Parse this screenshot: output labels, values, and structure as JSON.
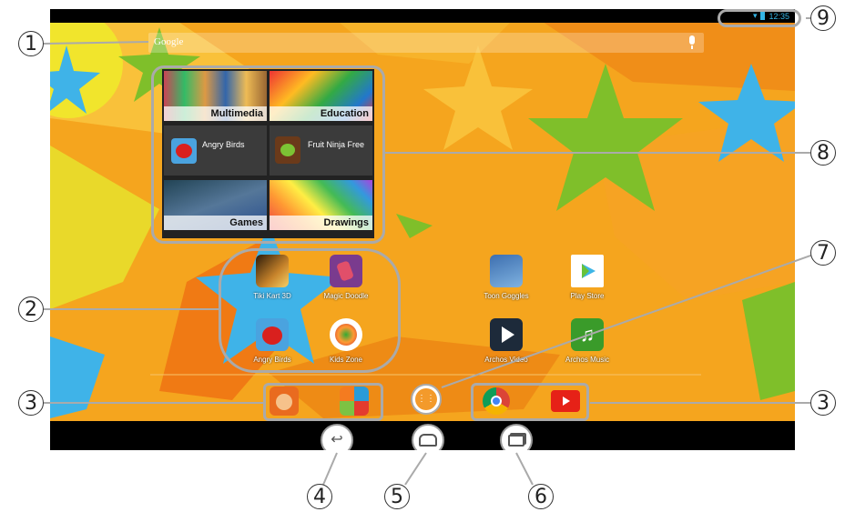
{
  "status": {
    "time": "12:35"
  },
  "search": {
    "placeholder": "Google"
  },
  "widgets": {
    "multimedia": "Multimedia",
    "education": "Education",
    "angry_birds": "Angry Birds",
    "fruit_ninja": "Fruit Ninja Free",
    "games": "Games",
    "drawings": "Drawings"
  },
  "apps": {
    "tiki_kart": "Tiki Kart 3D",
    "magic_doodle": "Magic Doodle",
    "angry_birds": "Angry Birds",
    "kids_zone": "Kids Zone",
    "toon_goggles": "Toon Goggles",
    "play_store": "Play Store",
    "archos_video": "Archos Video",
    "archos_music": "Archos Music"
  },
  "callouts": [
    "1",
    "2",
    "3",
    "3",
    "4",
    "5",
    "6",
    "7",
    "8",
    "9"
  ],
  "colors": {
    "background": "#f4a11c",
    "star_blue": "#3fb3e8",
    "star_green": "#7fbf2a",
    "frame": "#aaaaaa"
  }
}
